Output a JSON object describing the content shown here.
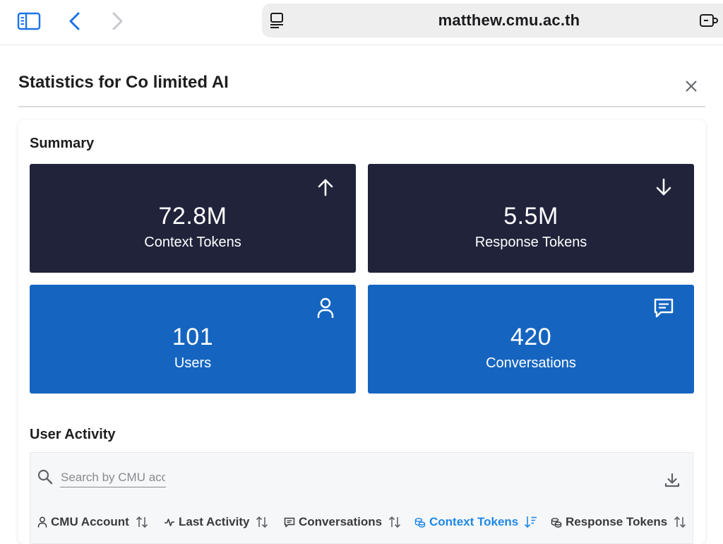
{
  "browser": {
    "url": "matthew.cmu.ac.th"
  },
  "dialog": {
    "title": "Statistics for Co limited AI"
  },
  "summary": {
    "title": "Summary",
    "cards": [
      {
        "value": "72.8M",
        "label": "Context Tokens",
        "icon": "arrow-up-icon",
        "color": "#20233a"
      },
      {
        "value": "5.5M",
        "label": "Response Tokens",
        "icon": "arrow-down-icon",
        "color": "#20233a"
      },
      {
        "value": "101",
        "label": "Users",
        "icon": "user-icon",
        "color": "#1565c0"
      },
      {
        "value": "420",
        "label": "Conversations",
        "icon": "chat-icon",
        "color": "#1565c0"
      }
    ]
  },
  "activity": {
    "title": "User Activity",
    "search_placeholder": "Search by CMU acc",
    "columns": [
      {
        "label": "CMU Account",
        "icon": "user-icon",
        "sort": "unsorted"
      },
      {
        "label": "Last Activity",
        "icon": "activity-icon",
        "sort": "unsorted"
      },
      {
        "label": "Conversations",
        "icon": "chat-icon",
        "sort": "unsorted"
      },
      {
        "label": "Context Tokens",
        "icon": "coins-icon",
        "sort": "descending"
      },
      {
        "label": "Response Tokens",
        "icon": "coins-icon",
        "sort": "unsorted"
      }
    ]
  },
  "colors": {
    "dark_card": "#20233a",
    "blue_card": "#1565c0",
    "accent": "#1e88e5",
    "browser_accent": "#1a73e8"
  }
}
